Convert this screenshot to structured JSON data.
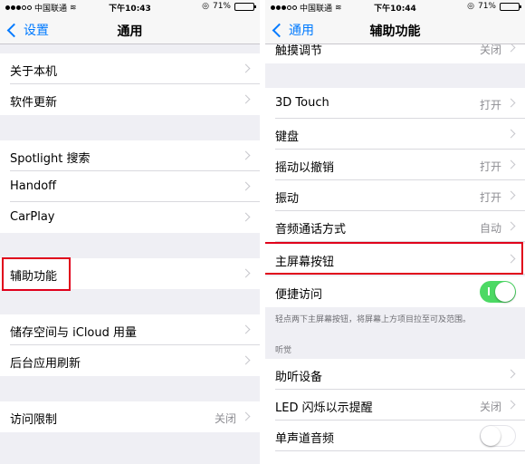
{
  "status": {
    "carrier": "中国联通",
    "battery_level": 0.71
  },
  "left": {
    "status": {
      "time": "下午10:43",
      "battery_text": "71%"
    },
    "nav": {
      "back_label": "设置",
      "title": "通用"
    },
    "items": [
      {
        "label": "关于本机",
        "value": ""
      },
      {
        "label": "软件更新",
        "value": ""
      },
      {
        "label": "Spotlight 搜索",
        "value": ""
      },
      {
        "label": "Handoff",
        "value": ""
      },
      {
        "label": "CarPlay",
        "value": ""
      },
      {
        "label": "辅助功能",
        "value": ""
      },
      {
        "label": "储存空间与 iCloud 用量",
        "value": ""
      },
      {
        "label": "后台应用刷新",
        "value": ""
      },
      {
        "label": "访问限制",
        "value": "关闭"
      }
    ]
  },
  "right": {
    "status": {
      "time": "下午10:44",
      "battery_text": "71%"
    },
    "nav": {
      "back_label": "通用",
      "title": "辅助功能"
    },
    "items": [
      {
        "label": "触摸调节",
        "value": "关闭"
      },
      {
        "label": "3D Touch",
        "value": "打开"
      },
      {
        "label": "键盘",
        "value": ""
      },
      {
        "label": "摇动以撤销",
        "value": "打开"
      },
      {
        "label": "振动",
        "value": "打开"
      },
      {
        "label": "音频通话方式",
        "value": "自动"
      },
      {
        "label": "主屏幕按钮",
        "value": ""
      },
      {
        "label": "便捷访问",
        "toggle": true
      },
      {
        "label": "助听设备",
        "value": ""
      },
      {
        "label": "LED 闪烁以示提醒",
        "value": "关闭"
      },
      {
        "label": "单声道音频",
        "toggle": false
      }
    ],
    "reachability_footer": "轻点两下主屏幕按钮，将屏幕上方项目拉至可及范围。",
    "section_hearing": "听觉"
  },
  "colors": {
    "accent": "#007aff",
    "highlight": "#e0001b",
    "switch_on": "#4cd964"
  }
}
